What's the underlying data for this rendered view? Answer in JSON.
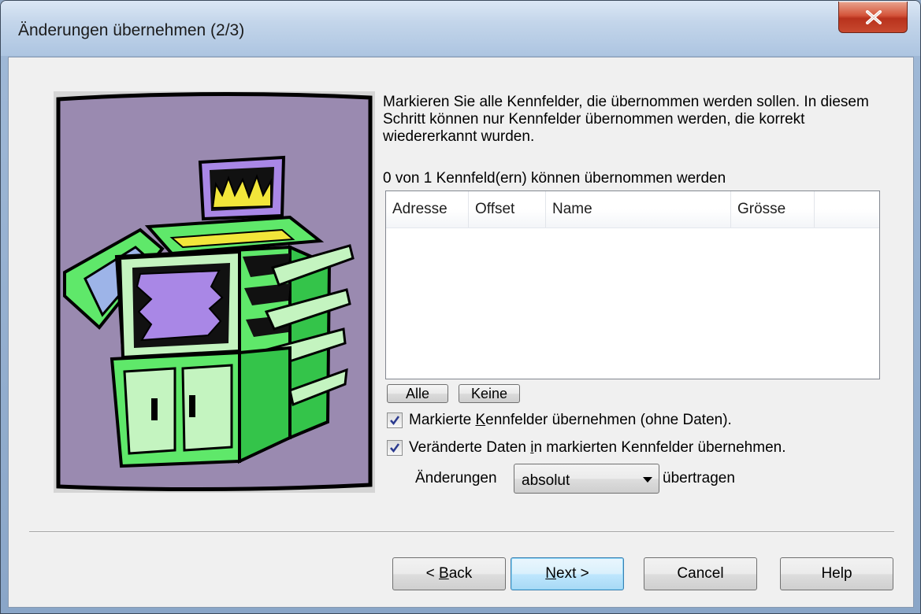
{
  "window": {
    "title": "Änderungen übernehmen (2/3)",
    "close_label": "X"
  },
  "instructions": "Markieren Sie alle Kennfelder, die übernommen werden sollen. In diesem Schritt können nur Kennfelder übernommen werden, die korrekt wiedererkannt wurden.",
  "count_label": "0 von 1 Kennfeld(ern) können übernommen werden",
  "table": {
    "columns": [
      "Adresse",
      "Offset",
      "Name",
      "Grösse"
    ],
    "rows": []
  },
  "select_buttons": {
    "all": "Alle",
    "none": "Keine"
  },
  "options": {
    "take_marked": {
      "prefix": "Markierte ",
      "mnemonic": "K",
      "suffix": "ennfelder übernehmen (ohne Daten).",
      "checked": true
    },
    "take_changed": {
      "prefix": "Veränderte Daten ",
      "mnemonic": "i",
      "suffix": "n markierten Kennfelder übernehmen.",
      "checked": true
    }
  },
  "transfer": {
    "label_before": "Änderungen",
    "value": "absolut",
    "label_after": "übertragen"
  },
  "buttons": {
    "back": {
      "prefix": "< ",
      "mnemonic": "B",
      "suffix": "ack"
    },
    "next": {
      "mnemonic": "N",
      "suffix": "ext >"
    },
    "cancel": "Cancel",
    "help": "Help"
  },
  "icons": {
    "close": "close-icon",
    "checkbox": "checkmark-icon",
    "dropdown": "chevron-down-icon",
    "illustration": "copier-machine-illustration"
  },
  "colors": {
    "accent_default_button": "#3c7fb1",
    "close_button": "#c8492f",
    "illustration_background": "#9a8ab0"
  }
}
